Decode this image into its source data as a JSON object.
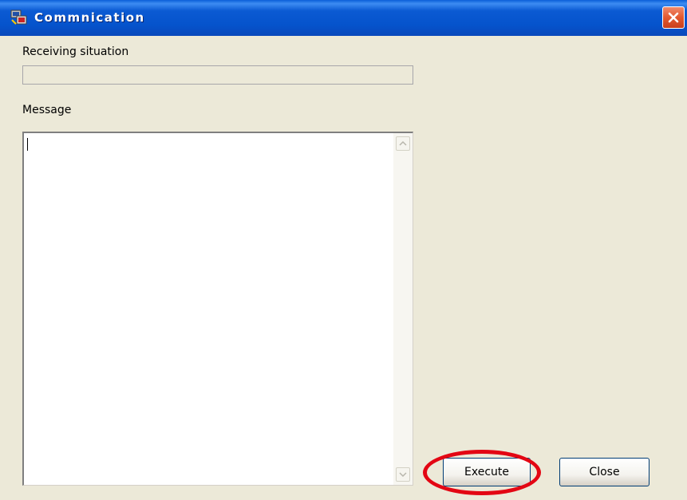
{
  "window": {
    "title": "Commnication",
    "icon": "communication-app-icon",
    "close_icon": "close-icon"
  },
  "receiving": {
    "label": "Receiving situation",
    "progress": 0
  },
  "message": {
    "label": "Message",
    "value": ""
  },
  "buttons": {
    "execute_label": "Execute",
    "close_label": "Close"
  },
  "colors": {
    "title_bar": "#0553cc",
    "dialog_background": "#ece9d8",
    "close_button": "#e2582f",
    "annotation": "#e30613"
  }
}
